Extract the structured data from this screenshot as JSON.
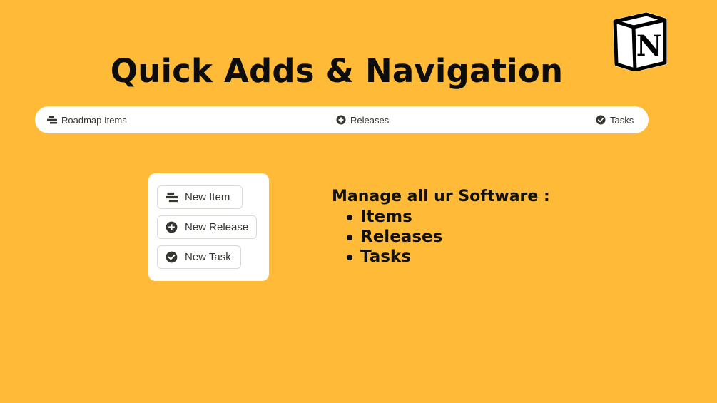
{
  "header": {
    "title": "Quick Adds & Navigation",
    "logo_icon": "notion-logo-icon"
  },
  "colors": {
    "background": "#FFBB38",
    "card": "#ffffff",
    "text": "#37352f",
    "icon": "#37352f"
  },
  "nav": {
    "items": [
      {
        "label": "Roadmap Items",
        "icon": "roadmap-lines-icon"
      },
      {
        "label": "Releases",
        "icon": "plus-circle-icon"
      },
      {
        "label": "Tasks",
        "icon": "check-circle-icon"
      }
    ]
  },
  "quick_add": {
    "buttons": [
      {
        "label": "New Item",
        "icon": "roadmap-lines-icon"
      },
      {
        "label": "New Release",
        "icon": "plus-circle-icon"
      },
      {
        "label": "New Task",
        "icon": "check-circle-icon"
      }
    ]
  },
  "description": {
    "heading": "Manage all ur Software :",
    "bullets": [
      "Items",
      "Releases",
      "Tasks"
    ]
  }
}
